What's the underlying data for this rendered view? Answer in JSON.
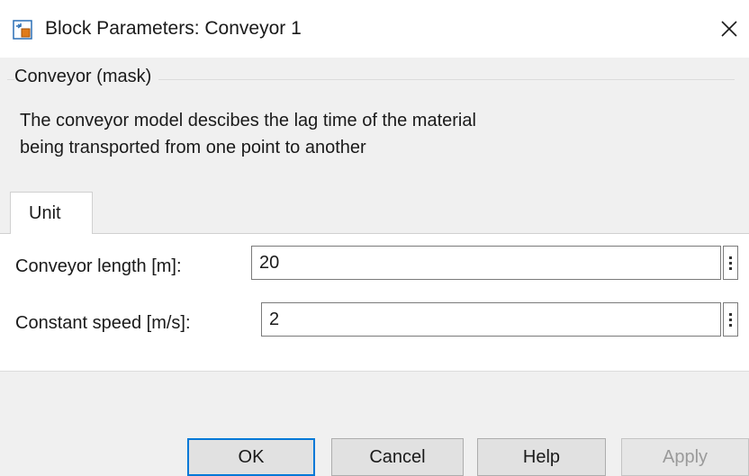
{
  "window": {
    "title": "Block Parameters: Conveyor 1",
    "icon": "simulink-block-icon",
    "close_icon": "close-icon"
  },
  "mask": {
    "heading": "Conveyor (mask)",
    "description_lines": [
      "The conveyor model descibes the lag time of the material",
      "being transported from one point to another"
    ]
  },
  "tabs": [
    {
      "label": "Unit",
      "selected": true
    }
  ],
  "parameters": [
    {
      "label": "Conveyor length [m]:",
      "value": "20"
    },
    {
      "label": "Constant speed [m/s]:",
      "value": "2"
    }
  ],
  "buttons": {
    "ok": "OK",
    "cancel": "Cancel",
    "help": "Help",
    "apply": "Apply"
  },
  "colors": {
    "default_button_border": "#0078d7",
    "disabled_text": "#9a9a9a"
  }
}
